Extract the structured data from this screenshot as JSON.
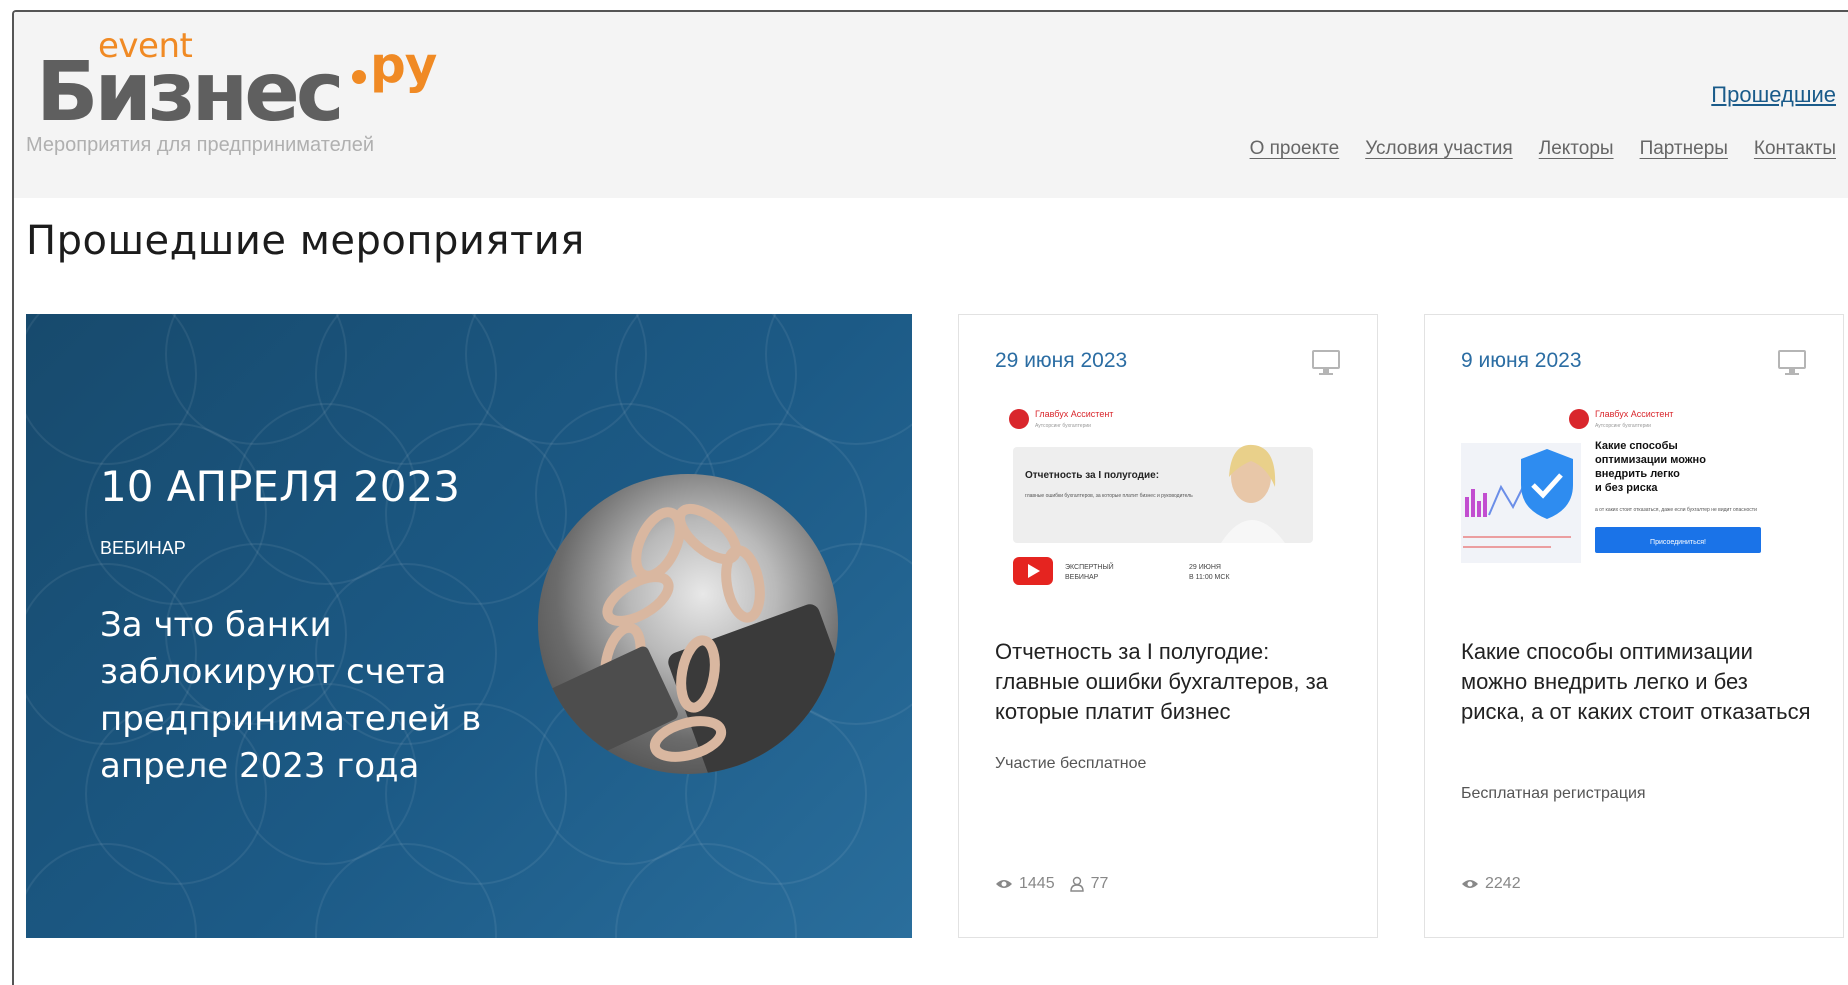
{
  "logo": {
    "event": "event",
    "main": "Бизнес",
    "domain": "ру",
    "tagline": "Мероприятия для предпринимателей"
  },
  "top_link": "Прошедшие",
  "nav": [
    "О проекте",
    "Условия участия",
    "Лекторы",
    "Партнеры",
    "Контакты"
  ],
  "page_title": "Прошедшие мероприятия",
  "hero": {
    "date": "10 АПРЕЛЯ 2023",
    "type": "ВЕБИНАР",
    "title": "За что банки заблокируют счета предпринимателей в апреле 2023 года"
  },
  "cards": [
    {
      "date": "29 июня 2023",
      "title": "Отчетность за I полугодие: главные ошибки бухгалтеров, за которые платит бизнес",
      "note": "Участие бесплатное",
      "views": "1445",
      "participants": "77",
      "image": {
        "brand": "Главбух Ассистент",
        "brand_sub": "Аутсорсинг бухгалтерии",
        "heading": "Отчетность за I полугодие:",
        "sub": "главные ошибки бухгалтеров, за которые платит бизнес и руководитель",
        "badge_line1": "ЭКСПЕРТНЫЙ",
        "badge_line2": "ВЕБИНАР",
        "when_line1": "29 ИЮНЯ",
        "when_line2": "В 11:00 МСК"
      }
    },
    {
      "date": "9 июня 2023",
      "title": "Какие способы оптимизации можно внедрить легко и без риска, а от каких стоит отказаться",
      "note": "Бесплатная регистрация",
      "views": "2242",
      "image": {
        "brand": "Главбух Ассистент",
        "brand_sub": "Аутсорсинг бухгалтерии",
        "heading_lines": [
          "Какие способы",
          "оптимизации можно",
          "внедрить легко",
          "и без риска"
        ],
        "sub": "а от каких стоит отказаться, даже если бухгалтер не видит опасности",
        "button": "Присоединиться!"
      }
    }
  ],
  "colors": {
    "accent_orange": "#f08a24",
    "link_blue": "#2b6da3",
    "hero_blue": "#1c5a86"
  }
}
